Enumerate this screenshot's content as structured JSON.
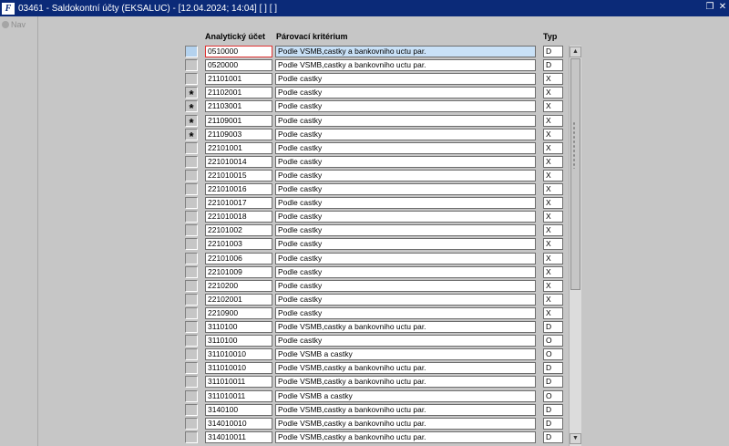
{
  "window": {
    "icon_label": "F",
    "title": "03461 - Saldokontní účty (EKSALUC) - [12.04.2024; 14:04] [ ] [ ]",
    "restore_glyph": "❐",
    "close_glyph": "✕"
  },
  "nav": {
    "label": "Nav"
  },
  "columns": {
    "account": "Analytický účet",
    "criterion": "Párovací kritérium",
    "type": "Typ"
  },
  "rows": [
    {
      "marker": "",
      "account": "0510000",
      "criterion": "Podle VSMB,castky a bankovniho uctu par.",
      "type": "D"
    },
    {
      "marker": "",
      "account": "0520000",
      "criterion": "Podle VSMB,castky a bankovniho uctu par.",
      "type": "D"
    },
    {
      "marker": "",
      "account": "21101001",
      "criterion": "Podle castky",
      "type": "X"
    },
    {
      "marker": "*",
      "account": "21102001",
      "criterion": "Podle castky",
      "type": "X"
    },
    {
      "marker": "*",
      "account": "21103001",
      "criterion": "Podle castky",
      "type": "X"
    },
    {
      "marker": "*",
      "account": "21109001",
      "criterion": "Podle castky",
      "type": "X"
    },
    {
      "marker": "*",
      "account": "21109003",
      "criterion": "Podle castky",
      "type": "X"
    },
    {
      "marker": "",
      "account": "22101001",
      "criterion": "Podle castky",
      "type": "X"
    },
    {
      "marker": "",
      "account": "221010014",
      "criterion": "Podle castky",
      "type": "X"
    },
    {
      "marker": "",
      "account": "221010015",
      "criterion": "Podle castky",
      "type": "X"
    },
    {
      "marker": "",
      "account": "221010016",
      "criterion": "Podle castky",
      "type": "X"
    },
    {
      "marker": "",
      "account": "221010017",
      "criterion": "Podle castky",
      "type": "X"
    },
    {
      "marker": "",
      "account": "221010018",
      "criterion": "Podle castky",
      "type": "X"
    },
    {
      "marker": "",
      "account": "22101002",
      "criterion": "Podle castky",
      "type": "X"
    },
    {
      "marker": "",
      "account": "22101003",
      "criterion": "Podle castky",
      "type": "X"
    },
    {
      "marker": "",
      "account": "22101006",
      "criterion": "Podle castky",
      "type": "X"
    },
    {
      "marker": "",
      "account": "22101009",
      "criterion": "Podle castky",
      "type": "X"
    },
    {
      "marker": "",
      "account": "2210200",
      "criterion": "Podle castky",
      "type": "X"
    },
    {
      "marker": "",
      "account": "22102001",
      "criterion": "Podle castky",
      "type": "X"
    },
    {
      "marker": "",
      "account": "2210900",
      "criterion": "Podle castky",
      "type": "X"
    },
    {
      "marker": "",
      "account": "3110100",
      "criterion": "Podle VSMB,castky a bankovniho uctu par.",
      "type": "D"
    },
    {
      "marker": "",
      "account": "3110100",
      "criterion": "Podle castky",
      "type": "O"
    },
    {
      "marker": "",
      "account": "311010010",
      "criterion": "Podle VSMB a castky",
      "type": "O"
    },
    {
      "marker": "",
      "account": "311010010",
      "criterion": "Podle VSMB,castky a bankovniho uctu par.",
      "type": "D"
    },
    {
      "marker": "",
      "account": "311010011",
      "criterion": "Podle VSMB,castky a bankovniho uctu par.",
      "type": "D"
    },
    {
      "marker": "",
      "account": "311010011",
      "criterion": "Podle VSMB a castky",
      "type": "O"
    },
    {
      "marker": "",
      "account": "3140100",
      "criterion": "Podle VSMB,castky a bankovniho uctu par.",
      "type": "D"
    },
    {
      "marker": "",
      "account": "314010010",
      "criterion": "Podle VSMB,castky a bankovniho uctu par.",
      "type": "D"
    },
    {
      "marker": "",
      "account": "314010011",
      "criterion": "Podle VSMB,castky a bankovniho uctu par.",
      "type": "D"
    }
  ],
  "scrollbar": {
    "up_glyph": "▲",
    "down_glyph": "▼"
  }
}
